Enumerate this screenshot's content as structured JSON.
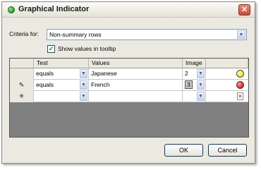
{
  "window": {
    "title": "Graphical Indicator",
    "close_glyph": "✕"
  },
  "criteria": {
    "label": "Criteria for:",
    "value": "Non-summary rows"
  },
  "tooltip": {
    "checked": true,
    "label": "Show values in tooltip"
  },
  "grid": {
    "headers": {
      "test": "Test",
      "values": "Values",
      "image": "Image"
    },
    "rows": [
      {
        "marker": "",
        "test": "equals",
        "value": "Japanese",
        "image_index": "2",
        "indicator": "yellow-circle",
        "color": "#f2e41a"
      },
      {
        "marker": "pencil-icon",
        "marker_glyph": "✎",
        "test": "equals",
        "value": "French",
        "image_index": "3",
        "indicator": "red-circle",
        "color": "#e21b1b"
      },
      {
        "marker": "new-row-icon",
        "marker_glyph": "✳",
        "test": "",
        "value": "",
        "image_index": "",
        "indicator": "no-image-icon"
      }
    ]
  },
  "buttons": {
    "ok": "OK",
    "cancel": "Cancel"
  },
  "icons": {
    "dropdown_glyph": "▼",
    "check_glyph": "✓",
    "no_image_glyph": "×"
  }
}
